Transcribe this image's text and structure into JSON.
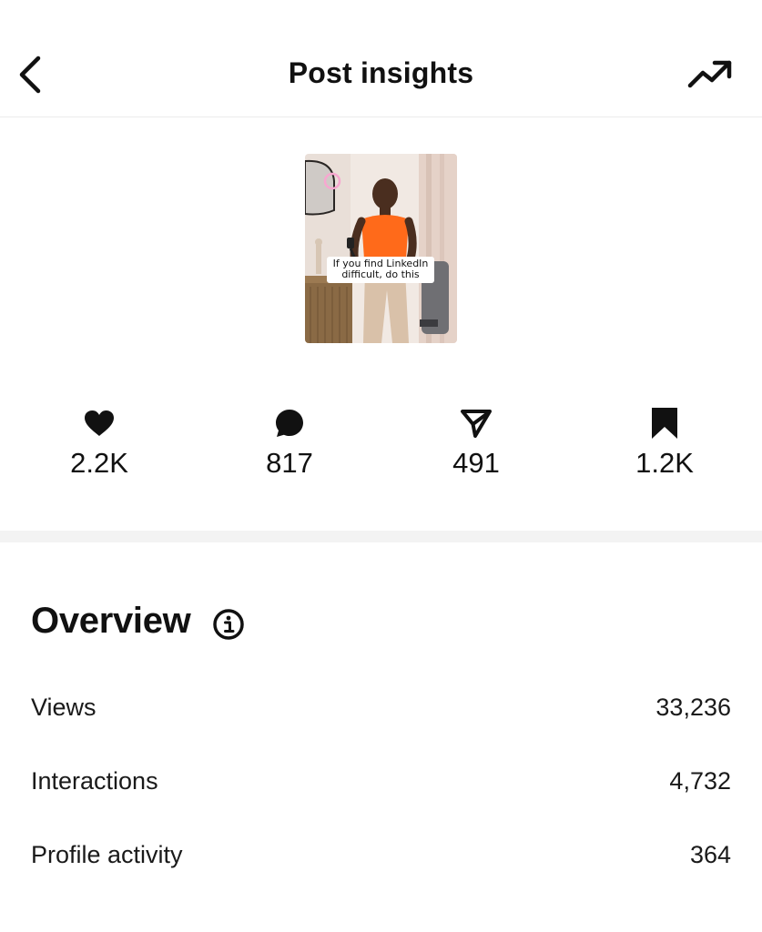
{
  "header": {
    "title": "Post insights",
    "back_icon": "chevron-left-icon",
    "trend_icon": "trending-up-icon"
  },
  "post": {
    "caption": "If you find LinkedIn difficult, do this"
  },
  "stats": {
    "likes": {
      "icon": "heart-icon",
      "value": "2.2K"
    },
    "comments": {
      "icon": "comment-bubble-icon",
      "value": "817"
    },
    "shares": {
      "icon": "paper-plane-icon",
      "value": "491"
    },
    "saves": {
      "icon": "bookmark-icon",
      "value": "1.2K"
    }
  },
  "overview": {
    "title": "Overview",
    "info_icon": "info-icon",
    "rows": [
      {
        "label": "Views",
        "value": "33,236"
      },
      {
        "label": "Interactions",
        "value": "4,732"
      },
      {
        "label": "Profile activity",
        "value": "364"
      }
    ]
  },
  "colors": {
    "text": "#111111",
    "divider": "#f3f3f3",
    "accent_thumbnail_top": "#ff6a1a"
  }
}
